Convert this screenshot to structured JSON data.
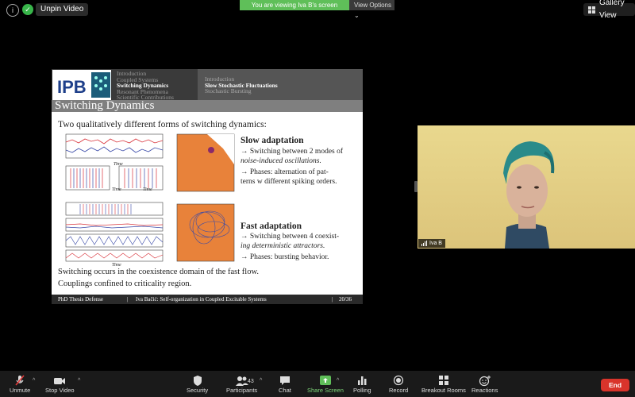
{
  "topbar": {
    "info_icon": "info-icon",
    "shield_icon": "shield-check-icon",
    "unpin_label": "Unpin Video",
    "viewing_banner": "You are viewing Iva B's screen",
    "view_options": "View Options",
    "gallery_view": "Gallery View"
  },
  "slide": {
    "logo_text": "IPB",
    "nav_left": [
      "Introduction",
      "Coupled Systems",
      "Switching Dynamics",
      "Resonant Phenomena",
      "Scientific Contributions"
    ],
    "nav_right": [
      "Introduction",
      "Slow Stochastic Fluctuations",
      "Stochastic Bursting"
    ],
    "title": "Switching Dynamics",
    "intro": "Two qualitatively different forms of switching dynamics:",
    "slow_heading": "Slow adaptation",
    "slow_line1": "→ Switching between 2 modes of",
    "slow_line2": "noise-induced oscillations.",
    "slow_line3": "→ Phases: alternation of pat-",
    "slow_line4": "terns w different spiking orders.",
    "fast_heading": "Fast adaptation",
    "fast_line1": "→ Switching between 4 coexist-",
    "fast_line2": "ing deterministic attractors.",
    "fast_line3": "→ Phases: bursting behavior.",
    "conclusion1": "Switching occurs in the coexistence domain of the fast flow.",
    "conclusion2": "Couplings confined to criticality region.",
    "axis_time": "Time",
    "footer_left": "PhD Thesis Defense",
    "footer_mid": "Iva Bačić: Self-organization in Coupled Excitable Systems",
    "footer_page": "20/36"
  },
  "participant": {
    "name": "Iva B"
  },
  "toolbar": {
    "unmute": "Unmute",
    "stop_video": "Stop Video",
    "security": "Security",
    "participants": "Participants",
    "participants_count": "43",
    "chat": "Chat",
    "share_screen": "Share Screen",
    "polling": "Polling",
    "record": "Record",
    "breakout": "Breakout Rooms",
    "reactions": "Reactions",
    "end": "End"
  },
  "colors": {
    "share_green": "#5fbf59",
    "end_red": "#d9342b",
    "phase_orange": "#e8823a",
    "trace_blue": "#3a4aa8",
    "trace_red": "#d8323a"
  }
}
